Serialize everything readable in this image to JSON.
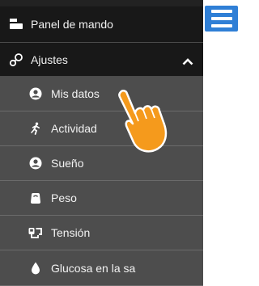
{
  "colors": {
    "panel_bg": "#222222",
    "header_row_bg": "#181818",
    "submenu_bg": "#4d4d4d",
    "menu_button": "#2f7fd6",
    "hand": "#f59a1c"
  },
  "menu_button_icon": "hamburger-icon",
  "items": [
    {
      "label": "Panel de mando",
      "icon": "dashboard-icon"
    },
    {
      "label": "Ajustes",
      "icon": "settings-link-icon",
      "expanded": true
    }
  ],
  "submenu": [
    {
      "label": "Mis datos",
      "icon": "user-icon"
    },
    {
      "label": "Actividad",
      "icon": "running-person-icon"
    },
    {
      "label": "Sueño",
      "icon": "user-icon"
    },
    {
      "label": "Peso",
      "icon": "scale-icon"
    },
    {
      "label": "Tensión",
      "icon": "blood-pressure-icon"
    },
    {
      "label": "Glucosa en la sa",
      "icon": "drop-icon"
    }
  ],
  "pointer": "pointing-hand-icon"
}
